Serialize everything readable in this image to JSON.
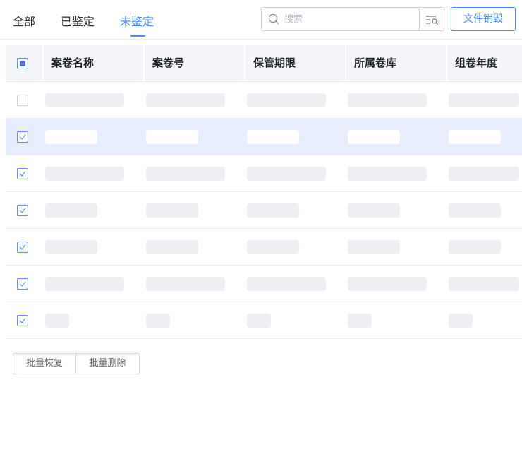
{
  "tabs": [
    {
      "label": "全部",
      "active": false
    },
    {
      "label": "已鉴定",
      "active": false
    },
    {
      "label": "未鉴定",
      "active": true
    }
  ],
  "search": {
    "placeholder": "搜索",
    "value": ""
  },
  "toolbar": {
    "primary_label": "文件销毁",
    "filter_icon": "filter-search-icon"
  },
  "table": {
    "header_checkbox": "indeterminate",
    "columns": [
      "案卷名称",
      "案卷号",
      "保管期限",
      "所属卷库",
      "组卷年度"
    ],
    "rows": [
      {
        "checked": false,
        "highlighted": false,
        "placeholder_size": "long"
      },
      {
        "checked": true,
        "highlighted": true,
        "placeholder_size": "medium"
      },
      {
        "checked": true,
        "highlighted": false,
        "placeholder_size": "long"
      },
      {
        "checked": true,
        "highlighted": false,
        "placeholder_size": "medium"
      },
      {
        "checked": true,
        "highlighted": false,
        "placeholder_size": "medium"
      },
      {
        "checked": true,
        "highlighted": false,
        "placeholder_size": "long"
      },
      {
        "checked": true,
        "highlighted": false,
        "placeholder_size": "short"
      }
    ]
  },
  "footer": {
    "restore_label": "批量恢复",
    "delete_label": "批量删除"
  },
  "colors": {
    "accent": "#4b8bf5",
    "row_highlight": "#e7edfc",
    "skeleton": "#eeeff3"
  }
}
